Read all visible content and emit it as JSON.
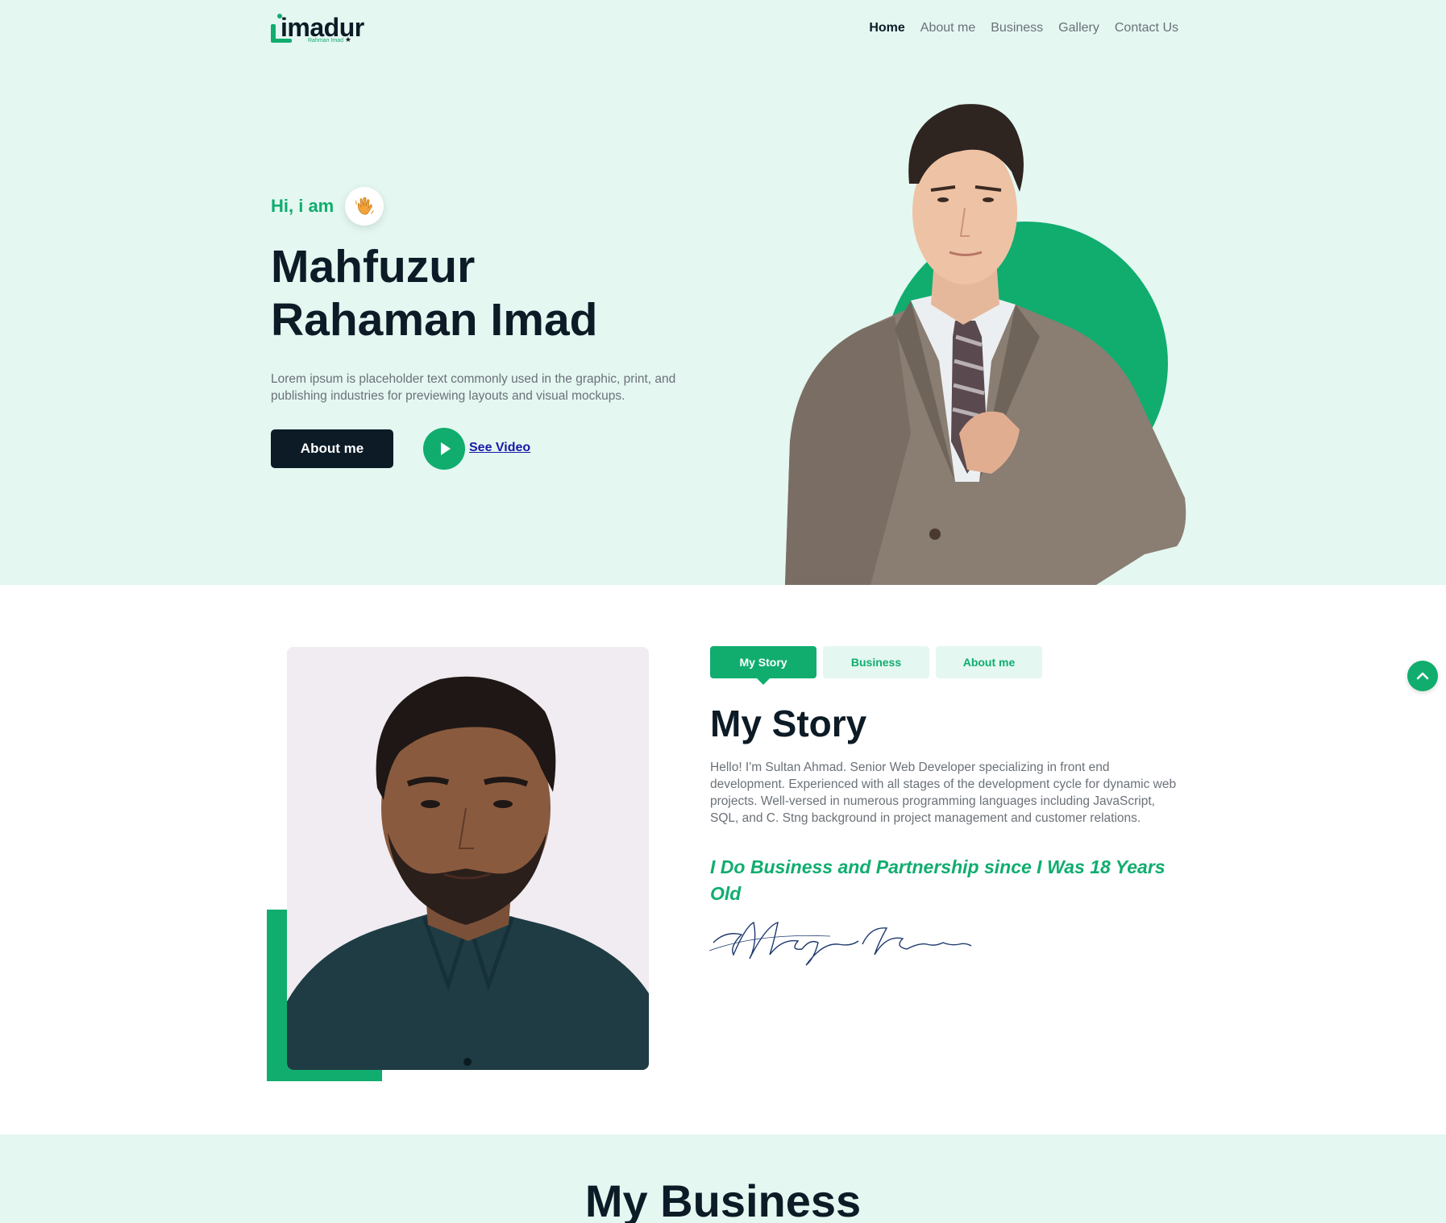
{
  "brand": {
    "logo_text": "imadur",
    "logo_subtext": "Rahman Imad",
    "accent_color": "#10ad6f",
    "dark_color": "#0c1b26"
  },
  "nav": {
    "items": [
      {
        "label": "Home",
        "active": true
      },
      {
        "label": "About me",
        "active": false
      },
      {
        "label": "Business",
        "active": false
      },
      {
        "label": "Gallery",
        "active": false
      },
      {
        "label": "Contact Us",
        "active": false
      }
    ]
  },
  "hero": {
    "greeting": "Hi, i am",
    "wave_icon": "waving-hand-icon",
    "name_line1": "Mahfuzur",
    "name_line2": "Rahaman Imad",
    "description": "Lorem ipsum is placeholder text commonly used in the graphic, print, and publishing industries for previewing layouts and visual mockups.",
    "about_button": "About me",
    "video_link": "See Video"
  },
  "story": {
    "tabs": [
      {
        "label": "My Story",
        "active": true
      },
      {
        "label": "Business",
        "active": false
      },
      {
        "label": "About me",
        "active": false
      }
    ],
    "title": "My Story",
    "body": "Hello! I'm Sultan Ahmad. Senior Web Developer specializing in front end development. Experienced with all stages of the development cycle for dynamic web projects. Well-versed in numerous programming languages including JavaScript, SQL, and C. Stng background in project management and customer relations.",
    "quote": "I Do Business and Partnership since I Was 18 Years Old",
    "signature": "Mafuzur Rahman"
  },
  "business": {
    "title": "My Business"
  }
}
